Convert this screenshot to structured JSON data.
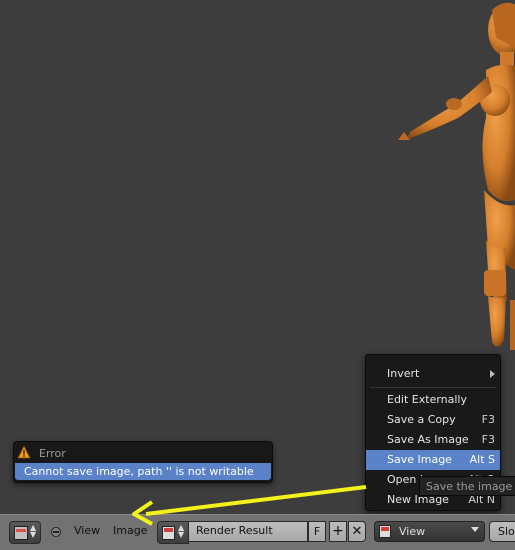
{
  "header": {
    "menus": [
      "View",
      "Image"
    ],
    "image_name": "Render Result",
    "fake_user": "F",
    "view_mode": "View",
    "slot": "Slot"
  },
  "error_popup": {
    "title": "Error",
    "message": "Cannot save image, path '' is not writable"
  },
  "context_menu": {
    "items": [
      {
        "label": "Invert",
        "shortcut": "",
        "submenu": true
      },
      {
        "label": "Edit Externally",
        "shortcut": ""
      },
      {
        "label": "Save a Copy",
        "shortcut": "F3"
      },
      {
        "label": "Save As Image",
        "shortcut": "F3"
      },
      {
        "label": "Save Image",
        "shortcut": "Alt S",
        "active": true
      },
      {
        "label": "Open Image",
        "shortcut": "Alt O"
      },
      {
        "label": "New Image",
        "shortcut": "Alt N"
      }
    ]
  },
  "tooltip": "Save the image",
  "colors": {
    "viewport_bg": "#3d3d3d",
    "header_bg": "#727272",
    "menu_bg": "#191919",
    "highlight": "#5a82c8",
    "figure_orange": "#d98a3a",
    "annotation_yellow": "#f2f21a"
  }
}
